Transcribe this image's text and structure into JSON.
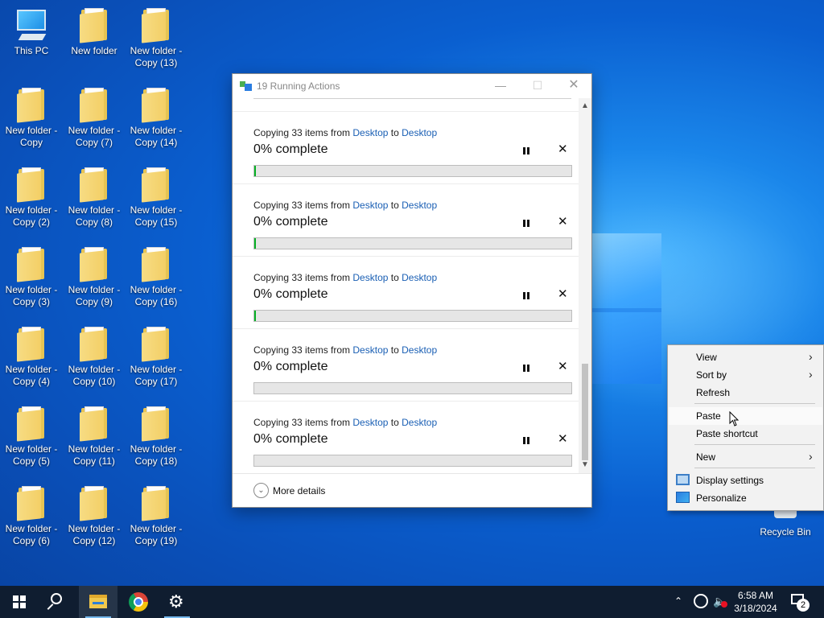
{
  "desktop": {
    "icons": [
      {
        "label": "This PC",
        "type": "pc"
      },
      {
        "label": "New folder",
        "type": "folder"
      },
      {
        "label": "New folder - Copy (13)",
        "type": "folder"
      },
      {
        "label": "New folder - Copy",
        "type": "folder"
      },
      {
        "label": "New folder - Copy (7)",
        "type": "folder"
      },
      {
        "label": "New folder - Copy (14)",
        "type": "folder"
      },
      {
        "label": "New folder - Copy (2)",
        "type": "folder"
      },
      {
        "label": "New folder - Copy (8)",
        "type": "folder"
      },
      {
        "label": "New folder - Copy (15)",
        "type": "folder"
      },
      {
        "label": "New folder - Copy (3)",
        "type": "folder"
      },
      {
        "label": "New folder - Copy (9)",
        "type": "folder"
      },
      {
        "label": "New folder - Copy (16)",
        "type": "folder"
      },
      {
        "label": "New folder - Copy (4)",
        "type": "folder"
      },
      {
        "label": "New folder - Copy (10)",
        "type": "folder"
      },
      {
        "label": "New folder - Copy (17)",
        "type": "folder"
      },
      {
        "label": "New folder - Copy (5)",
        "type": "folder"
      },
      {
        "label": "New folder - Copy (11)",
        "type": "folder"
      },
      {
        "label": "New folder - Copy (18)",
        "type": "folder"
      },
      {
        "label": "New folder - Copy (6)",
        "type": "folder"
      },
      {
        "label": "New folder - Copy (12)",
        "type": "folder"
      },
      {
        "label": "New folder - Copy (19)",
        "type": "folder"
      }
    ],
    "recycle_bin": "Recycle Bin"
  },
  "progress_window": {
    "title": "19 Running Actions",
    "operations": [
      {
        "prefix": "Copying 33 items from ",
        "from": "Desktop",
        "mid": " to ",
        "to": "Desktop",
        "percent_text": "0% complete",
        "progress": 0.005
      },
      {
        "prefix": "Copying 33 items from ",
        "from": "Desktop",
        "mid": " to ",
        "to": "Desktop",
        "percent_text": "0% complete",
        "progress": 0.005
      },
      {
        "prefix": "Copying 33 items from ",
        "from": "Desktop",
        "mid": " to ",
        "to": "Desktop",
        "percent_text": "0% complete",
        "progress": 0.005
      },
      {
        "prefix": "Copying 33 items from ",
        "from": "Desktop",
        "mid": " to ",
        "to": "Desktop",
        "percent_text": "0% complete",
        "progress": 0
      },
      {
        "prefix": "Copying 33 items from ",
        "from": "Desktop",
        "mid": " to ",
        "to": "Desktop",
        "percent_text": "0% complete",
        "progress": 0
      }
    ],
    "more_details": "More details"
  },
  "context_menu": {
    "items": [
      {
        "label": "View",
        "submenu": true
      },
      {
        "label": "Sort by",
        "submenu": true
      },
      {
        "label": "Refresh",
        "submenu": false
      },
      {
        "label": "Paste",
        "submenu": false,
        "hover": true
      },
      {
        "label": "Paste shortcut",
        "submenu": false
      },
      {
        "label": "New",
        "submenu": true
      },
      {
        "label": "Display settings",
        "submenu": false,
        "icon": "display-icon"
      },
      {
        "label": "Personalize",
        "submenu": false,
        "icon": "personalize-icon"
      }
    ]
  },
  "taskbar": {
    "time": "6:58 AM",
    "date": "3/18/2024",
    "notification_count": "2"
  },
  "colors": {
    "progress_fill": "#06b025",
    "link": "#1a5fb4",
    "taskbar": "#0f1d30"
  }
}
